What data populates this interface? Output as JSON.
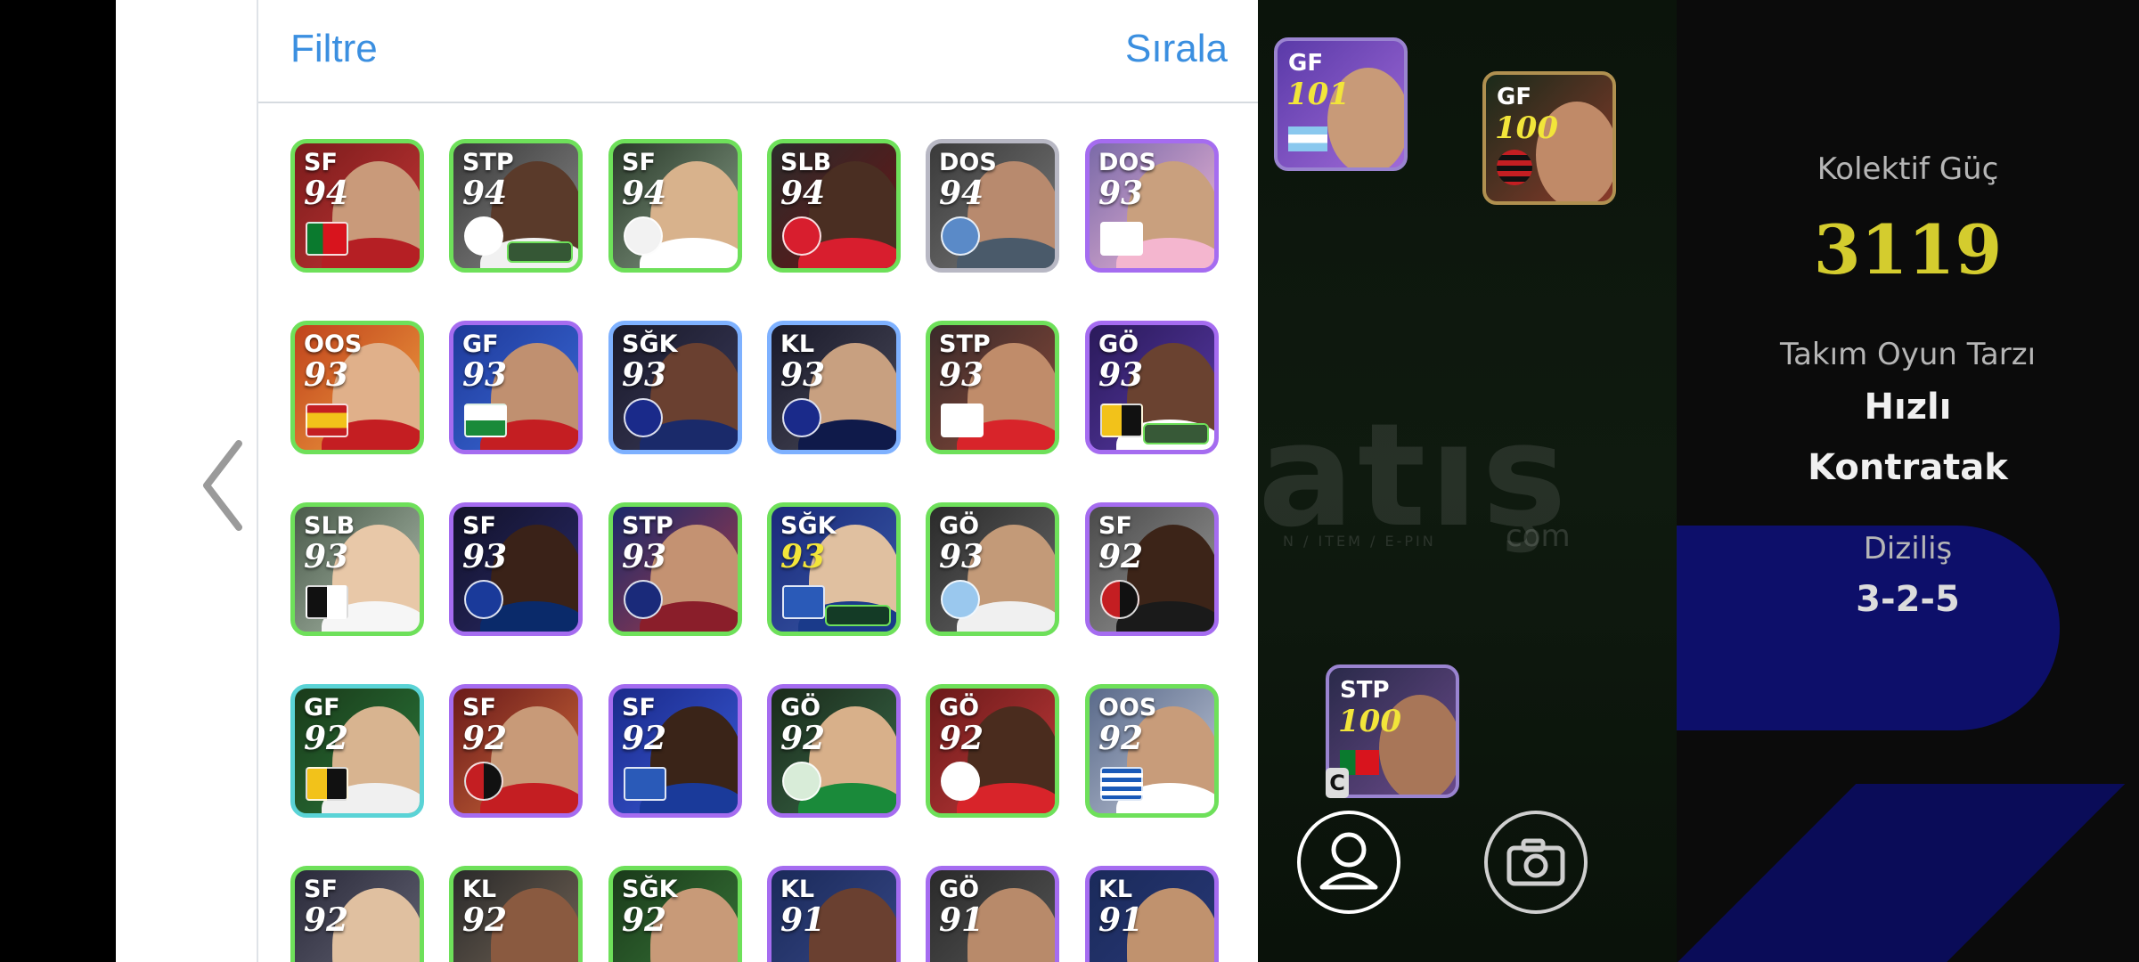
{
  "panel": {
    "filter_label": "Filtre",
    "sort_label": "Sırala"
  },
  "players": [
    {
      "pos": "SF",
      "ovr": "94"
    },
    {
      "pos": "STP",
      "ovr": "94"
    },
    {
      "pos": "SF",
      "ovr": "94"
    },
    {
      "pos": "SLB",
      "ovr": "94"
    },
    {
      "pos": "DOS",
      "ovr": "94"
    },
    {
      "pos": "DOS",
      "ovr": "93"
    },
    {
      "pos": "OOS",
      "ovr": "93"
    },
    {
      "pos": "GF",
      "ovr": "93"
    },
    {
      "pos": "SĞK",
      "ovr": "93"
    },
    {
      "pos": "KL",
      "ovr": "93"
    },
    {
      "pos": "STP",
      "ovr": "93"
    },
    {
      "pos": "GÖ",
      "ovr": "93"
    },
    {
      "pos": "SLB",
      "ovr": "93"
    },
    {
      "pos": "SF",
      "ovr": "93"
    },
    {
      "pos": "STP",
      "ovr": "93"
    },
    {
      "pos": "SĞK",
      "ovr": "93"
    },
    {
      "pos": "GÖ",
      "ovr": "93"
    },
    {
      "pos": "SF",
      "ovr": "92"
    },
    {
      "pos": "GF",
      "ovr": "92"
    },
    {
      "pos": "SF",
      "ovr": "92"
    },
    {
      "pos": "SF",
      "ovr": "92"
    },
    {
      "pos": "GÖ",
      "ovr": "92"
    },
    {
      "pos": "GÖ",
      "ovr": "92"
    },
    {
      "pos": "OOS",
      "ovr": "92"
    },
    {
      "pos": "SF",
      "ovr": "92"
    },
    {
      "pos": "KL",
      "ovr": "92"
    },
    {
      "pos": "SĞK",
      "ovr": "92"
    },
    {
      "pos": "KL",
      "ovr": "91"
    },
    {
      "pos": "GÖ",
      "ovr": "91"
    },
    {
      "pos": "KL",
      "ovr": "91"
    }
  ],
  "field": {
    "cards": [
      {
        "pos": "GF",
        "ovr": "101"
      },
      {
        "pos": "GF",
        "ovr": "100"
      },
      {
        "pos": "STP",
        "ovr": "100"
      }
    ],
    "captain_tag": "C"
  },
  "team_info": {
    "power_label": "Kolektif Güç",
    "power_value": "3119",
    "style_label": "Takım Oyun Tarzı",
    "style_value_1": "Hızlı",
    "style_value_2": "Kontratak",
    "formation_label": "Diziliş",
    "formation_value": "3-2-5"
  },
  "watermark": {
    "main": "atış",
    "sub": "N / ITEM / E-PIN",
    "com": "com"
  },
  "colors": {
    "link_blue": "#3b8fe0",
    "power_yellow": "#d4cc2e"
  }
}
